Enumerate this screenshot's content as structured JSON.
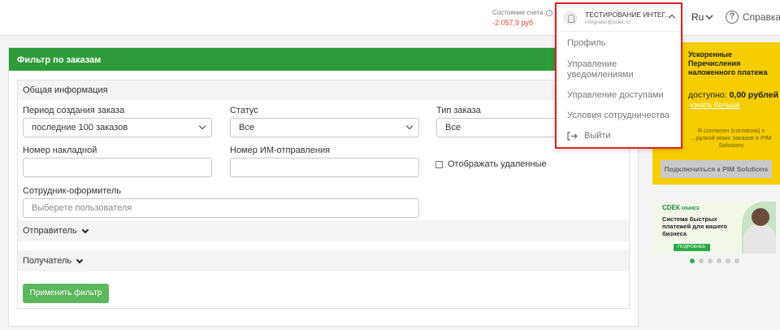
{
  "header": {
    "balance_label": "Состояние счета",
    "balance_info_icon": "i",
    "balance_value": "-2 057,9 руб",
    "language": "Ru",
    "help_label": "Справка",
    "help_icon": "?"
  },
  "user_menu": {
    "name": "ТЕСТИРОВАНИЕ ИНТЕГ...",
    "email": "integrator@cdek.ru",
    "items": [
      "Профиль",
      "Управление уведомлениями",
      "Управление доступами",
      "Условия сотрудничества",
      "Выйти"
    ]
  },
  "filter": {
    "title": "Фильтр по заказам",
    "section_general": "Общая информация",
    "period_label": "Период создания заказа",
    "period_value": "последние 100 заказов",
    "status_label": "Статус",
    "status_value": "Все",
    "type_label": "Тип заказа",
    "type_value": "Все",
    "waybill_label": "Номер накладной",
    "waybill_value": "",
    "im_label": "Номер ИМ-отправления",
    "im_value": "",
    "show_deleted_label": "Отображать удаленные",
    "employee_label": "Сотрудник-оформитель",
    "employee_placeholder": "Выберете пользователя",
    "sender_label": "Отправитель",
    "receiver_label": "Получатель",
    "apply_label": "Применить фильтр"
  },
  "promo": {
    "title": "Ускоренные Перечисления наложенного платежа",
    "available_prefix": "доступно:",
    "available_value": "0,00 рублей",
    "learn_more": "узнать больше",
    "agree_text": "Я согласен (согласна) с ...рузкой моих заказов в PIM Solutions",
    "connect_label": "Подключиться к PIM Solutions"
  },
  "banner": {
    "logo": "СDЕК",
    "logo_sub": "FINANCE",
    "text": "Система быстрых платежей для вашего бизнеса",
    "button": "ПОДРОБНЕЕ",
    "slides": 6,
    "active_slide": 1
  },
  "colors": {
    "brand_green": "#2e9c3a",
    "apply_green": "#5cb85c",
    "promo_yellow": "#f6cd00",
    "highlight_red": "#e02020",
    "negative_balance": "#e8453c"
  }
}
